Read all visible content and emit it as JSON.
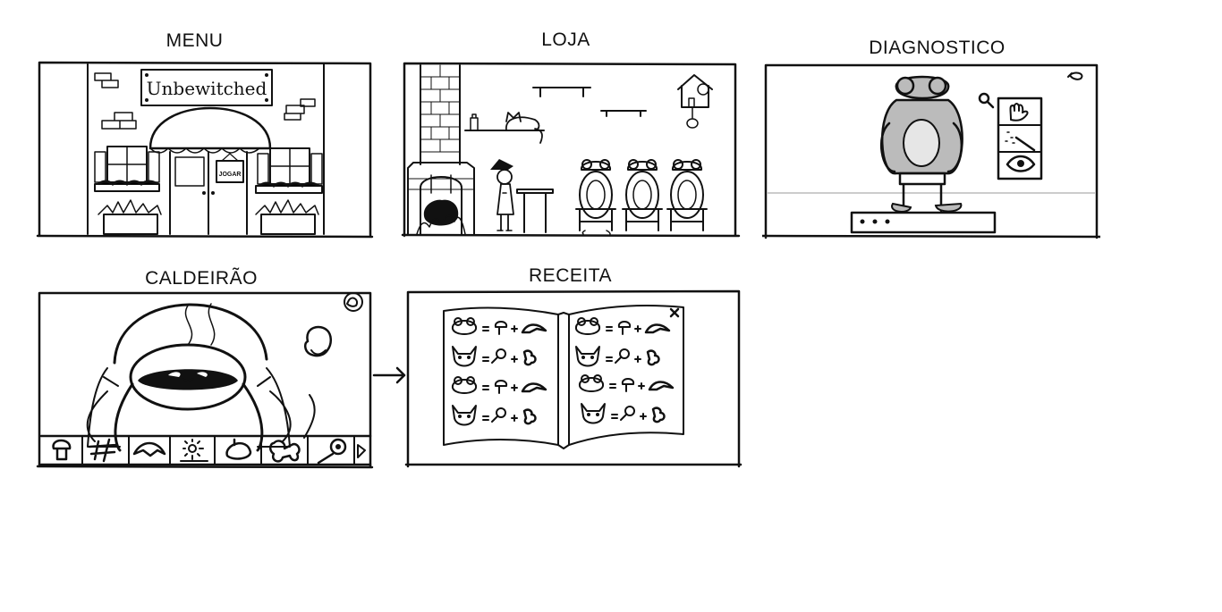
{
  "storyboard": {
    "panels": [
      {
        "id": "menu",
        "title": "MENU",
        "sign_text": "Unbewitched",
        "door_sign": "JOGAR"
      },
      {
        "id": "loja",
        "title": "LOJA"
      },
      {
        "id": "diagnostico",
        "title": "DIAGNOSTICO"
      },
      {
        "id": "caldeirao",
        "title": "CALDEIRÃO"
      },
      {
        "id": "receita",
        "title": "RECEITA"
      }
    ]
  }
}
